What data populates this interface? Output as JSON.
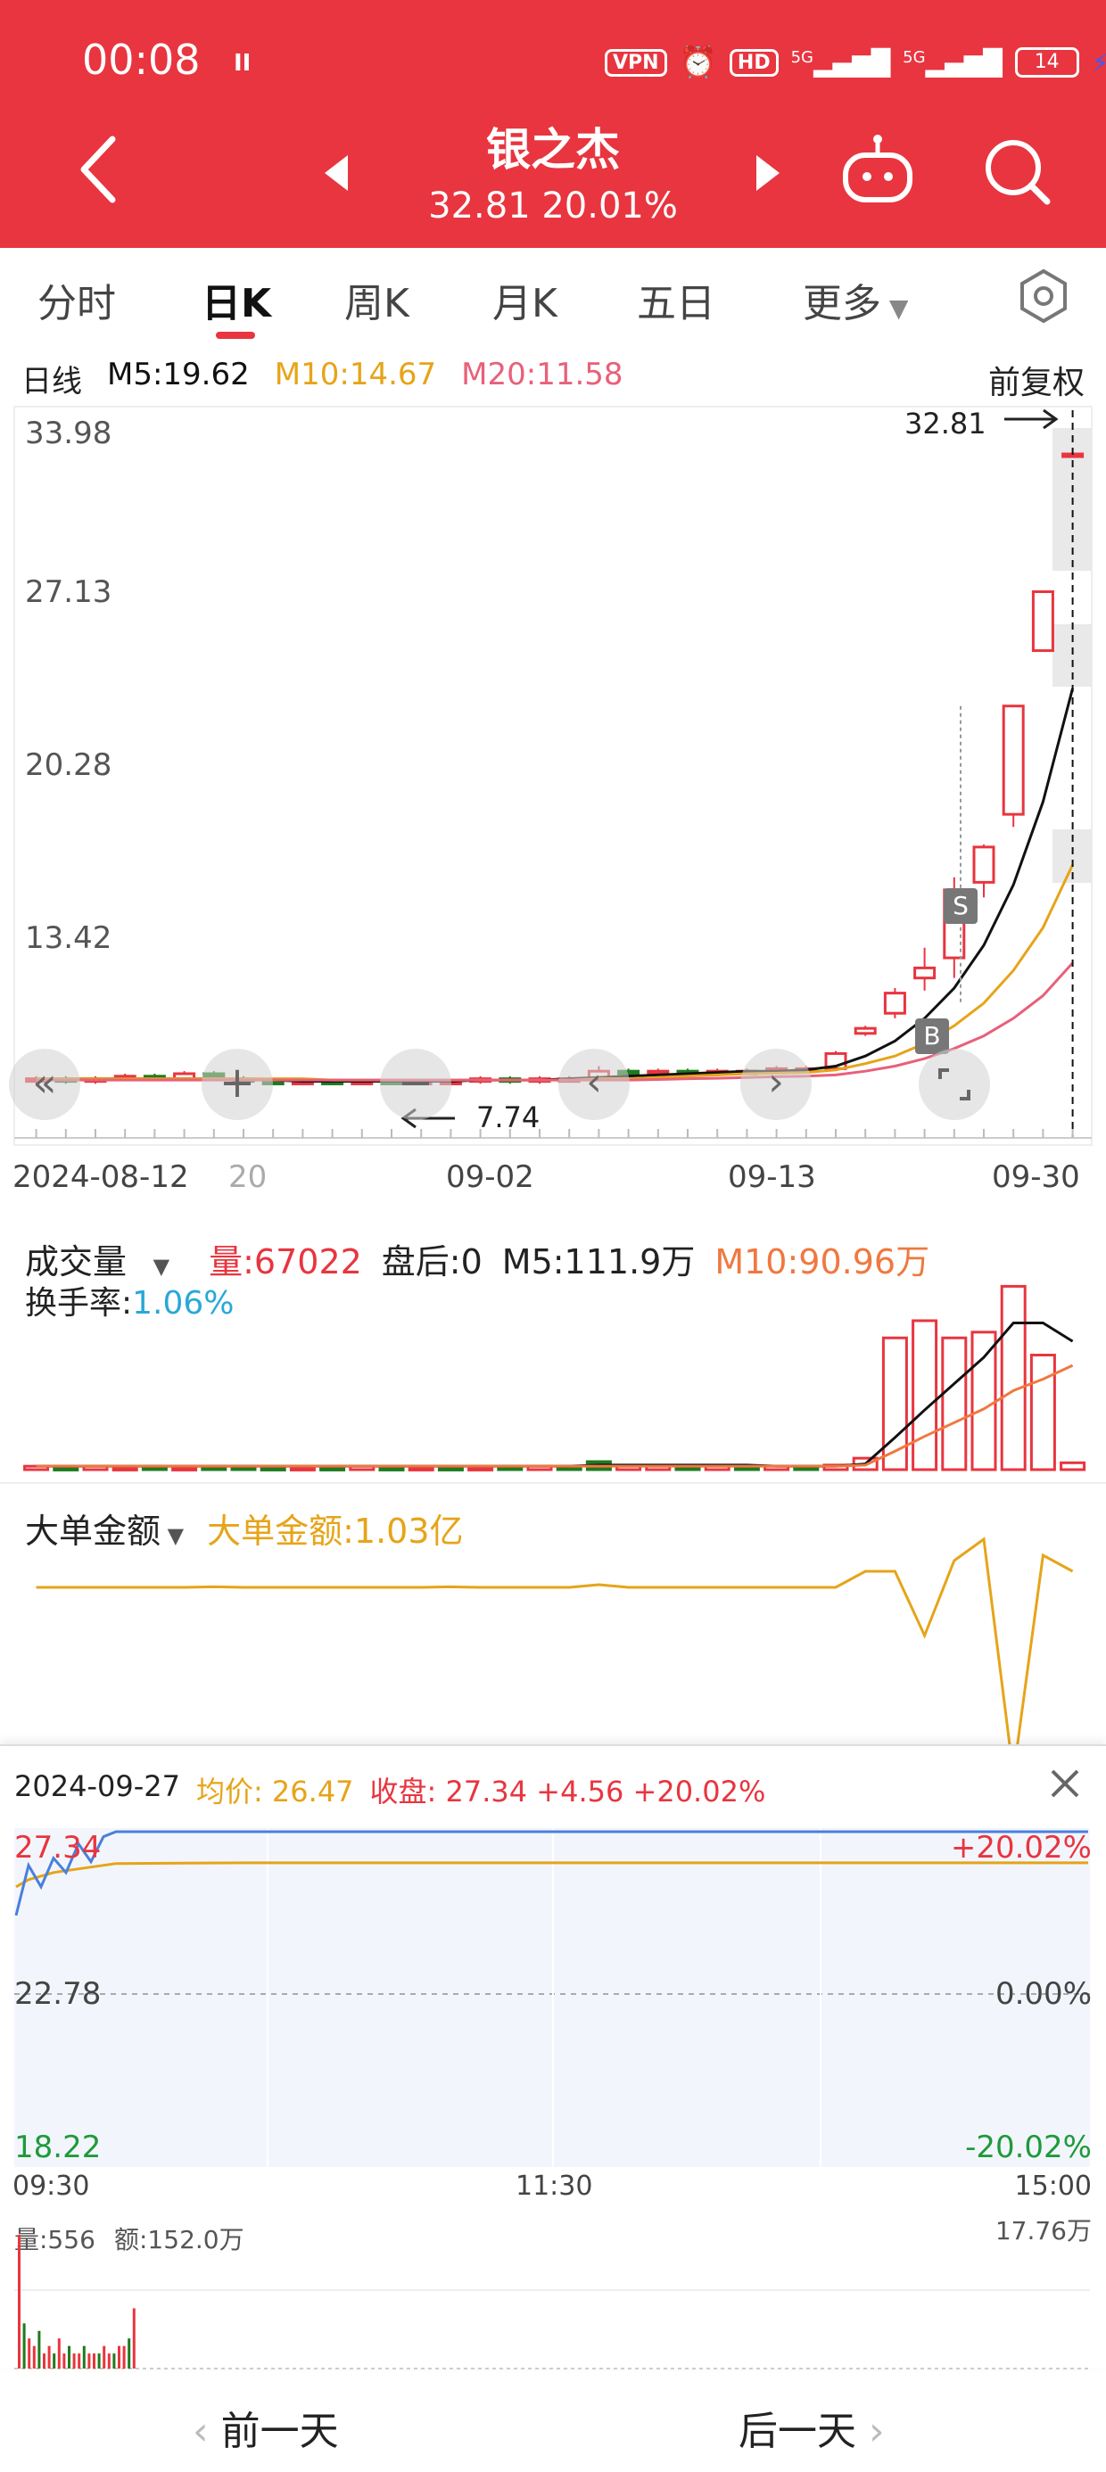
{
  "status": {
    "time": "00:08",
    "pause": "II",
    "vpn": "VPN",
    "hd": "HD",
    "net1": "5G",
    "net2": "5G",
    "battery": "14"
  },
  "header": {
    "name": "银之杰",
    "price_line": "32.81 20.01%"
  },
  "tabs": [
    {
      "label": "分时"
    },
    {
      "label": "日K"
    },
    {
      "label": "周K"
    },
    {
      "label": "月K"
    },
    {
      "label": "五日"
    },
    {
      "label": "更多"
    }
  ],
  "kline": {
    "period": "日线",
    "m5": "M5:19.62",
    "m10": "M10:14.67",
    "m20": "M20:11.58",
    "adjust": "前复权",
    "y_labels": [
      "33.98",
      "27.13",
      "20.28",
      "13.42"
    ],
    "latest": "32.81",
    "low_label": "7.74",
    "x_labels": [
      "2024-08-12",
      "20",
      "09-02",
      "09-13",
      "09-30"
    ],
    "marker_s": "S",
    "marker_b": "B",
    "colors": {
      "up": "#e8353f",
      "down": "#1f7a1f",
      "m5": "#111111",
      "m10": "#e6a419",
      "m20": "#e8607a"
    }
  },
  "volume": {
    "title": "成交量",
    "qty": "量:67022",
    "after": "盘后:0",
    "m5": "M5:111.9万",
    "m10": "M10:90.96万",
    "turnover_label": "换手率:",
    "turnover_value": "1.06%"
  },
  "bigorder": {
    "title": "大单金额",
    "value": "大单金额:1.03亿"
  },
  "intraday": {
    "date": "2024-09-27",
    "avg": "均价: 26.47",
    "close": "收盘: 27.34 +4.56 +20.02%",
    "y_top": "27.34",
    "y_mid": "22.78",
    "y_bot": "18.22",
    "pct_top": "+20.02%",
    "pct_mid": "0.00%",
    "pct_bot": "-20.02%",
    "t_start": "09:30",
    "t_mid": "11:30",
    "t_end": "15:00",
    "vol_label": "量:556",
    "amt_label": "额:152.0万",
    "vol_max": "17.76万"
  },
  "footer": {
    "prev": "前一天",
    "next": "后一天"
  },
  "chart_data": [
    {
      "type": "candlestick",
      "title": "日线",
      "ylim": [
        6.5,
        33.98
      ],
      "x_labels": [
        "2024-08-12",
        "20",
        "09-02",
        "09-13",
        "09-30"
      ],
      "candles": [
        {
          "o": 7.9,
          "c": 8.0,
          "h": 8.1,
          "l": 7.8
        },
        {
          "o": 8.0,
          "c": 7.9,
          "h": 8.1,
          "l": 7.8
        },
        {
          "o": 7.9,
          "c": 8.0,
          "h": 8.1,
          "l": 7.8
        },
        {
          "o": 8.0,
          "c": 8.1,
          "h": 8.2,
          "l": 7.9
        },
        {
          "o": 8.1,
          "c": 8.0,
          "h": 8.2,
          "l": 7.9
        },
        {
          "o": 8.0,
          "c": 8.2,
          "h": 8.3,
          "l": 7.9
        },
        {
          "o": 8.2,
          "c": 8.0,
          "h": 8.3,
          "l": 7.9
        },
        {
          "o": 8.0,
          "c": 7.9,
          "h": 8.1,
          "l": 7.8
        },
        {
          "o": 7.9,
          "c": 7.8,
          "h": 8.0,
          "l": 7.74
        },
        {
          "o": 7.8,
          "c": 7.9,
          "h": 8.0,
          "l": 7.74
        },
        {
          "o": 7.9,
          "c": 7.8,
          "h": 8.0,
          "l": 7.74
        },
        {
          "o": 7.8,
          "c": 7.9,
          "h": 8.0,
          "l": 7.74
        },
        {
          "o": 7.9,
          "c": 7.8,
          "h": 8.0,
          "l": 7.74
        },
        {
          "o": 7.8,
          "c": 7.9,
          "h": 8.0,
          "l": 7.74
        },
        {
          "o": 7.9,
          "c": 7.9,
          "h": 8.0,
          "l": 7.8
        },
        {
          "o": 7.9,
          "c": 8.0,
          "h": 8.1,
          "l": 7.8
        },
        {
          "o": 8.0,
          "c": 7.9,
          "h": 8.1,
          "l": 7.8
        },
        {
          "o": 7.9,
          "c": 8.0,
          "h": 8.1,
          "l": 7.8
        },
        {
          "o": 8.0,
          "c": 8.0,
          "h": 8.1,
          "l": 7.9
        },
        {
          "o": 8.0,
          "c": 8.3,
          "h": 8.5,
          "l": 7.9
        },
        {
          "o": 8.3,
          "c": 8.2,
          "h": 8.4,
          "l": 8.1
        },
        {
          "o": 8.2,
          "c": 8.3,
          "h": 8.4,
          "l": 8.1
        },
        {
          "o": 8.3,
          "c": 8.2,
          "h": 8.4,
          "l": 8.1
        },
        {
          "o": 8.2,
          "c": 8.3,
          "h": 8.4,
          "l": 8.1
        },
        {
          "o": 8.3,
          "c": 8.3,
          "h": 8.4,
          "l": 8.2
        },
        {
          "o": 8.3,
          "c": 8.4,
          "h": 8.5,
          "l": 8.2
        },
        {
          "o": 8.4,
          "c": 8.4,
          "h": 8.5,
          "l": 8.3
        },
        {
          "o": 8.4,
          "c": 9.0,
          "h": 9.1,
          "l": 8.4
        },
        {
          "o": 9.8,
          "c": 10.0,
          "h": 10.1,
          "l": 9.7
        },
        {
          "o": 10.6,
          "c": 11.4,
          "h": 11.6,
          "l": 10.4
        },
        {
          "o": 12.0,
          "c": 12.4,
          "h": 13.2,
          "l": 11.5
        },
        {
          "o": 12.8,
          "c": 15.5,
          "h": 16.0,
          "l": 12.0
        },
        {
          "o": 15.8,
          "c": 17.2,
          "h": 17.3,
          "l": 15.2
        },
        {
          "o": 18.5,
          "c": 22.8,
          "h": 22.8,
          "l": 18.0
        },
        {
          "o": 25.0,
          "c": 27.34,
          "h": 27.34,
          "l": 25.0
        },
        {
          "o": 32.81,
          "c": 32.81,
          "h": 32.81,
          "l": 32.81
        }
      ],
      "series": [
        {
          "name": "M5",
          "values": [
            8.0,
            8.0,
            8.0,
            8.0,
            8.0,
            8.0,
            8.0,
            8.0,
            7.95,
            7.9,
            7.9,
            7.9,
            7.9,
            7.9,
            7.9,
            7.95,
            7.95,
            7.95,
            8.0,
            8.05,
            8.1,
            8.15,
            8.2,
            8.25,
            8.3,
            8.3,
            8.35,
            8.5,
            8.9,
            9.5,
            10.4,
            11.6,
            13.3,
            15.7,
            19.0,
            23.5
          ]
        },
        {
          "name": "M10",
          "values": [
            8.0,
            8.0,
            8.0,
            8.0,
            8.0,
            8.0,
            8.0,
            8.0,
            8.0,
            8.0,
            7.95,
            7.95,
            7.95,
            7.95,
            7.95,
            7.95,
            7.95,
            7.95,
            7.95,
            8.0,
            8.0,
            8.05,
            8.1,
            8.15,
            8.2,
            8.22,
            8.25,
            8.35,
            8.6,
            8.9,
            9.4,
            10.1,
            11.0,
            12.3,
            14.0,
            16.5
          ]
        },
        {
          "name": "M20",
          "values": [
            7.95,
            7.95,
            7.95,
            7.95,
            7.95,
            7.95,
            7.95,
            7.95,
            7.95,
            7.95,
            7.95,
            7.95,
            7.95,
            7.95,
            7.95,
            7.95,
            7.95,
            7.95,
            7.95,
            7.95,
            7.95,
            7.97,
            8.0,
            8.02,
            8.05,
            8.08,
            8.1,
            8.15,
            8.3,
            8.5,
            8.8,
            9.2,
            9.7,
            10.4,
            11.3,
            12.6
          ]
        }
      ]
    },
    {
      "type": "bar",
      "title": "成交量",
      "values": [
        3,
        2,
        3,
        2,
        3,
        2,
        3,
        3,
        2,
        2,
        2,
        3,
        2,
        2,
        2,
        2,
        3,
        3,
        3,
        7,
        3,
        3,
        3,
        3,
        3,
        3,
        3,
        4,
        10,
        115,
        130,
        115,
        120,
        160,
        100,
        6
      ],
      "up": [
        true,
        false,
        true,
        true,
        false,
        true,
        false,
        false,
        false,
        true,
        false,
        true,
        false,
        true,
        false,
        true,
        false,
        true,
        false,
        false,
        true,
        true,
        false,
        true,
        false,
        true,
        false,
        true,
        true,
        true,
        true,
        true,
        true,
        true,
        true,
        true
      ],
      "series": [
        {
          "name": "M5",
          "values": [
            3,
            3,
            3,
            3,
            3,
            3,
            3,
            3,
            3,
            3,
            3,
            3,
            3,
            3,
            3,
            3,
            3,
            3,
            3,
            4,
            4,
            4,
            4,
            4,
            4,
            3,
            3,
            3,
            5,
            28,
            52,
            75,
            98,
            128,
            128,
            112
          ]
        },
        {
          "name": "M10",
          "values": [
            3,
            3,
            3,
            3,
            3,
            3,
            3,
            3,
            3,
            3,
            3,
            3,
            3,
            3,
            3,
            3,
            3,
            3,
            3,
            3,
            3,
            3,
            3,
            3,
            3,
            3,
            3,
            3,
            4,
            16,
            29,
            41,
            53,
            69,
            79,
            91
          ]
        }
      ]
    },
    {
      "type": "line",
      "title": "大单金额",
      "values": [
        0,
        0,
        0,
        0,
        0,
        0,
        0.01,
        0,
        0,
        0,
        0,
        0,
        0,
        0,
        0.01,
        0,
        0,
        0,
        0,
        0.05,
        0,
        0,
        0,
        0,
        0,
        0,
        0,
        0,
        0.3,
        0.3,
        -0.9,
        0.5,
        0.9,
        -3.5,
        0.6,
        0.3
      ]
    },
    {
      "type": "line",
      "title": "2024-09-27",
      "ylim": [
        18.22,
        27.34
      ],
      "x": [
        "09:30",
        "11:30",
        "15:00"
      ],
      "series": [
        {
          "name": "收盘",
          "values": [
            25.0,
            26.4,
            25.8,
            26.6,
            26.2,
            27.0,
            26.5,
            27.2,
            27.34,
            27.34,
            27.34,
            27.34,
            27.34,
            27.34,
            27.34,
            27.34,
            27.34,
            27.34,
            27.34,
            27.34,
            27.34,
            27.34,
            27.34,
            27.34
          ]
        },
        {
          "name": "均价",
          "values": [
            25.8,
            26.0,
            26.1,
            26.2,
            26.25,
            26.3,
            26.35,
            26.4,
            26.45,
            26.46,
            26.47,
            26.47,
            26.47,
            26.47,
            26.47,
            26.47,
            26.47,
            26.47,
            26.47,
            26.47,
            26.47,
            26.47,
            26.47,
            26.47
          ]
        }
      ],
      "volume": [
        17.76,
        6,
        4,
        3,
        5,
        2,
        3,
        2,
        4,
        2,
        3,
        2,
        2,
        3,
        2,
        2,
        2,
        3,
        2,
        2,
        3,
        3,
        4,
        8
      ]
    }
  ]
}
